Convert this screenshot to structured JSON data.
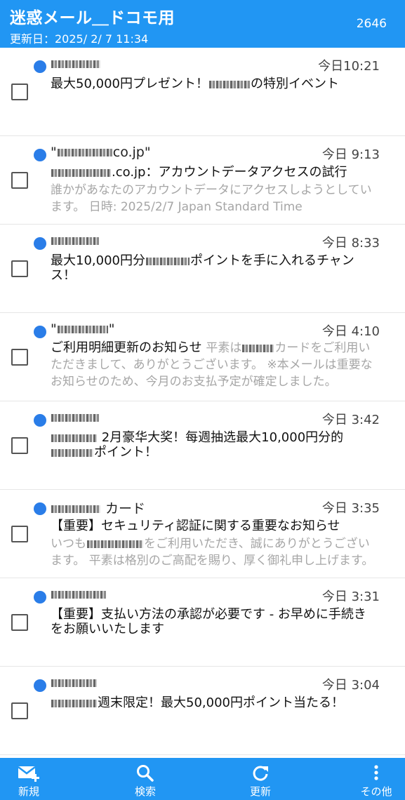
{
  "header": {
    "title": "迷惑メール＿ドコモ用",
    "updated": "更新日：2025/ 2/ 7 11:34",
    "count": "2646"
  },
  "messages": [
    {
      "sender": "",
      "sender_mask_w": 70,
      "time": "今日10:21",
      "subject_pre": "最大50,000円プレゼント！",
      "subject_mask_w": 58,
      "subject_post": "の特別イベント",
      "preview": ""
    },
    {
      "sender": "co.jp\"",
      "sender_mask_w": 78,
      "sender_pre_mask": "\"",
      "time": "今日 9:13",
      "subject_pre": "",
      "subject_mask_w": 85,
      "subject_post": ".co.jp：アカウントデータアクセスの試行",
      "preview": "誰かがあなたのアカウントデータにアクセスしようとしています。 日時: 2025/2/7 Japan Standard Time"
    },
    {
      "sender": "",
      "sender_mask_w": 68,
      "time": "今日 8:33",
      "subject_pre": "最大10,000円分",
      "subject_mask_w": 62,
      "subject_post": "ポイントを手に入れるチャンス！",
      "preview": ""
    },
    {
      "sender": "\"\"",
      "sender_mask_w": 72,
      "time": "今日 4:10",
      "subject_pre": "ご利用明細更新のお知らせ",
      "subject_mask_w": 0,
      "subject_post": "",
      "preview_pre": "平素は",
      "preview_mask_w": 45,
      "preview_post": "カードをご利用いただきまして、ありがとうございます。 ※本メールは重要なお知らせのため、今月のお支払予定が確定しました。"
    },
    {
      "sender": "",
      "sender_mask_w": 68,
      "time": "今日 3:42",
      "subject_pre": "",
      "subject_mask_w": 65,
      "subject_post": "2月豪华大奖！每週抽选最大10,000円分的",
      "subject_line2_mask_w": 60,
      "subject_line2": "ポイント！",
      "preview": ""
    },
    {
      "sender": "カード",
      "sender_mask_w": 70,
      "time": "今日 3:35",
      "subject_pre": "【重要】セキュリティ認証に関する重要なお知らせ",
      "subject_mask_w": 0,
      "subject_post": "",
      "preview_pre": "いつも",
      "preview_mask_w": 80,
      "preview_post": "をご利用いただき、誠にありがとうございます。 平素は格別のご高配を賜り、厚く御礼申し上げます。"
    },
    {
      "sender": "",
      "sender_mask_w": 78,
      "time": "今日 3:31",
      "subject_pre": "【重要】支払い方法の承認が必要です - お早めに手続きをお願いいたします",
      "subject_mask_w": 0,
      "subject_post": "",
      "preview": ""
    },
    {
      "sender": "",
      "sender_mask_w": 65,
      "time": "今日 3:04",
      "subject_pre": "",
      "subject_mask_w": 65,
      "subject_post": "週末限定！最大50,000円ポイント当たる！",
      "preview": ""
    }
  ],
  "bottom_nav": [
    {
      "label": "新規",
      "icon": "new-mail-icon"
    },
    {
      "label": "検索",
      "icon": "search-icon"
    },
    {
      "label": "更新",
      "icon": "refresh-icon"
    },
    {
      "label": "その他",
      "icon": "more-vertical-icon"
    }
  ],
  "colors": {
    "accent": "#2196f3",
    "unread_dot": "#2a7de8",
    "preview_text": "#a6a6a6"
  }
}
